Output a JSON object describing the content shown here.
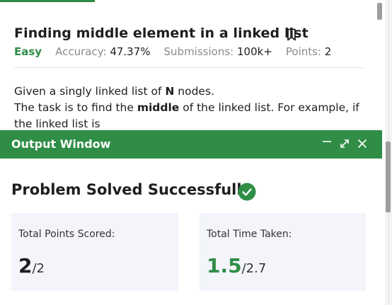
{
  "problem": {
    "title": "Finding middle element in a linked list",
    "difficulty": "Easy",
    "accuracy_label": "Accuracy:",
    "accuracy_value": "47.37%",
    "submissions_label": "Submissions:",
    "submissions_value": "100k+",
    "points_label": "Points:",
    "points_value": "2",
    "description": {
      "line1_pre": "Given a singly linked list of ",
      "line1_bold": "N",
      "line1_post": " nodes.",
      "line2_pre": "The task is to find the ",
      "line2_bold": "middle",
      "line2_post": " of the linked list. For example, if",
      "line3": "the linked list is"
    }
  },
  "output_window": {
    "title": "Output Window",
    "result_heading": "Problem Solved Successfully",
    "points_card": {
      "label": "Total Points Scored:",
      "value": "2",
      "total": "/2"
    },
    "time_card": {
      "label": "Total Time Taken:",
      "value": "1.5",
      "total": "/2.7"
    }
  },
  "colors": {
    "accent_green": "#2f8d46",
    "card_bg": "#f3f5fb",
    "muted_text": "#8a8a8a"
  },
  "icons": {
    "bookmark": "bookmark-icon",
    "minimize": "minimize-icon",
    "expand": "expand-icon",
    "close": "close-icon",
    "success": "check-circle-icon"
  }
}
